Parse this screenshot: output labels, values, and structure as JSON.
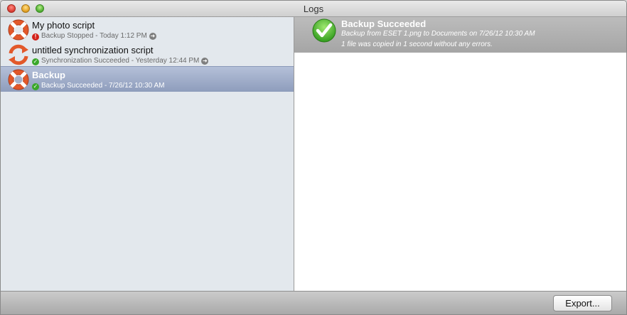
{
  "window": {
    "title": "Logs"
  },
  "scripts": [
    {
      "name": "My photo script",
      "status_icon": "error-dot-icon",
      "status_text": "Backup Stopped - Today 1:12 PM",
      "icon": "lifebuoy-icon",
      "selected": false
    },
    {
      "name": "untitled synchronization script",
      "status_icon": "check-dot-icon",
      "status_text": "Synchronization Succeeded - Yesterday 12:44 PM",
      "icon": "sync-arrows-icon",
      "selected": false
    },
    {
      "name": "Backup",
      "status_icon": "check-dot-icon",
      "status_text": "Backup Succeeded - 7/26/12 10:30 AM",
      "icon": "lifebuoy-icon",
      "selected": true
    }
  ],
  "detail": {
    "title": "Backup Succeeded",
    "line1": "Backup from ESET 1.png to Documents on 7/26/12 10:30 AM",
    "line2": "1 file was copied in 1 second without any errors."
  },
  "footer": {
    "export_label": "Export..."
  },
  "colors": {
    "selection": "#9aa8c6",
    "sidebar_bg": "#e3e8ed",
    "success_green": "#3aa82a",
    "error_red": "#d2211a",
    "accent_orange": "#e2582a"
  }
}
